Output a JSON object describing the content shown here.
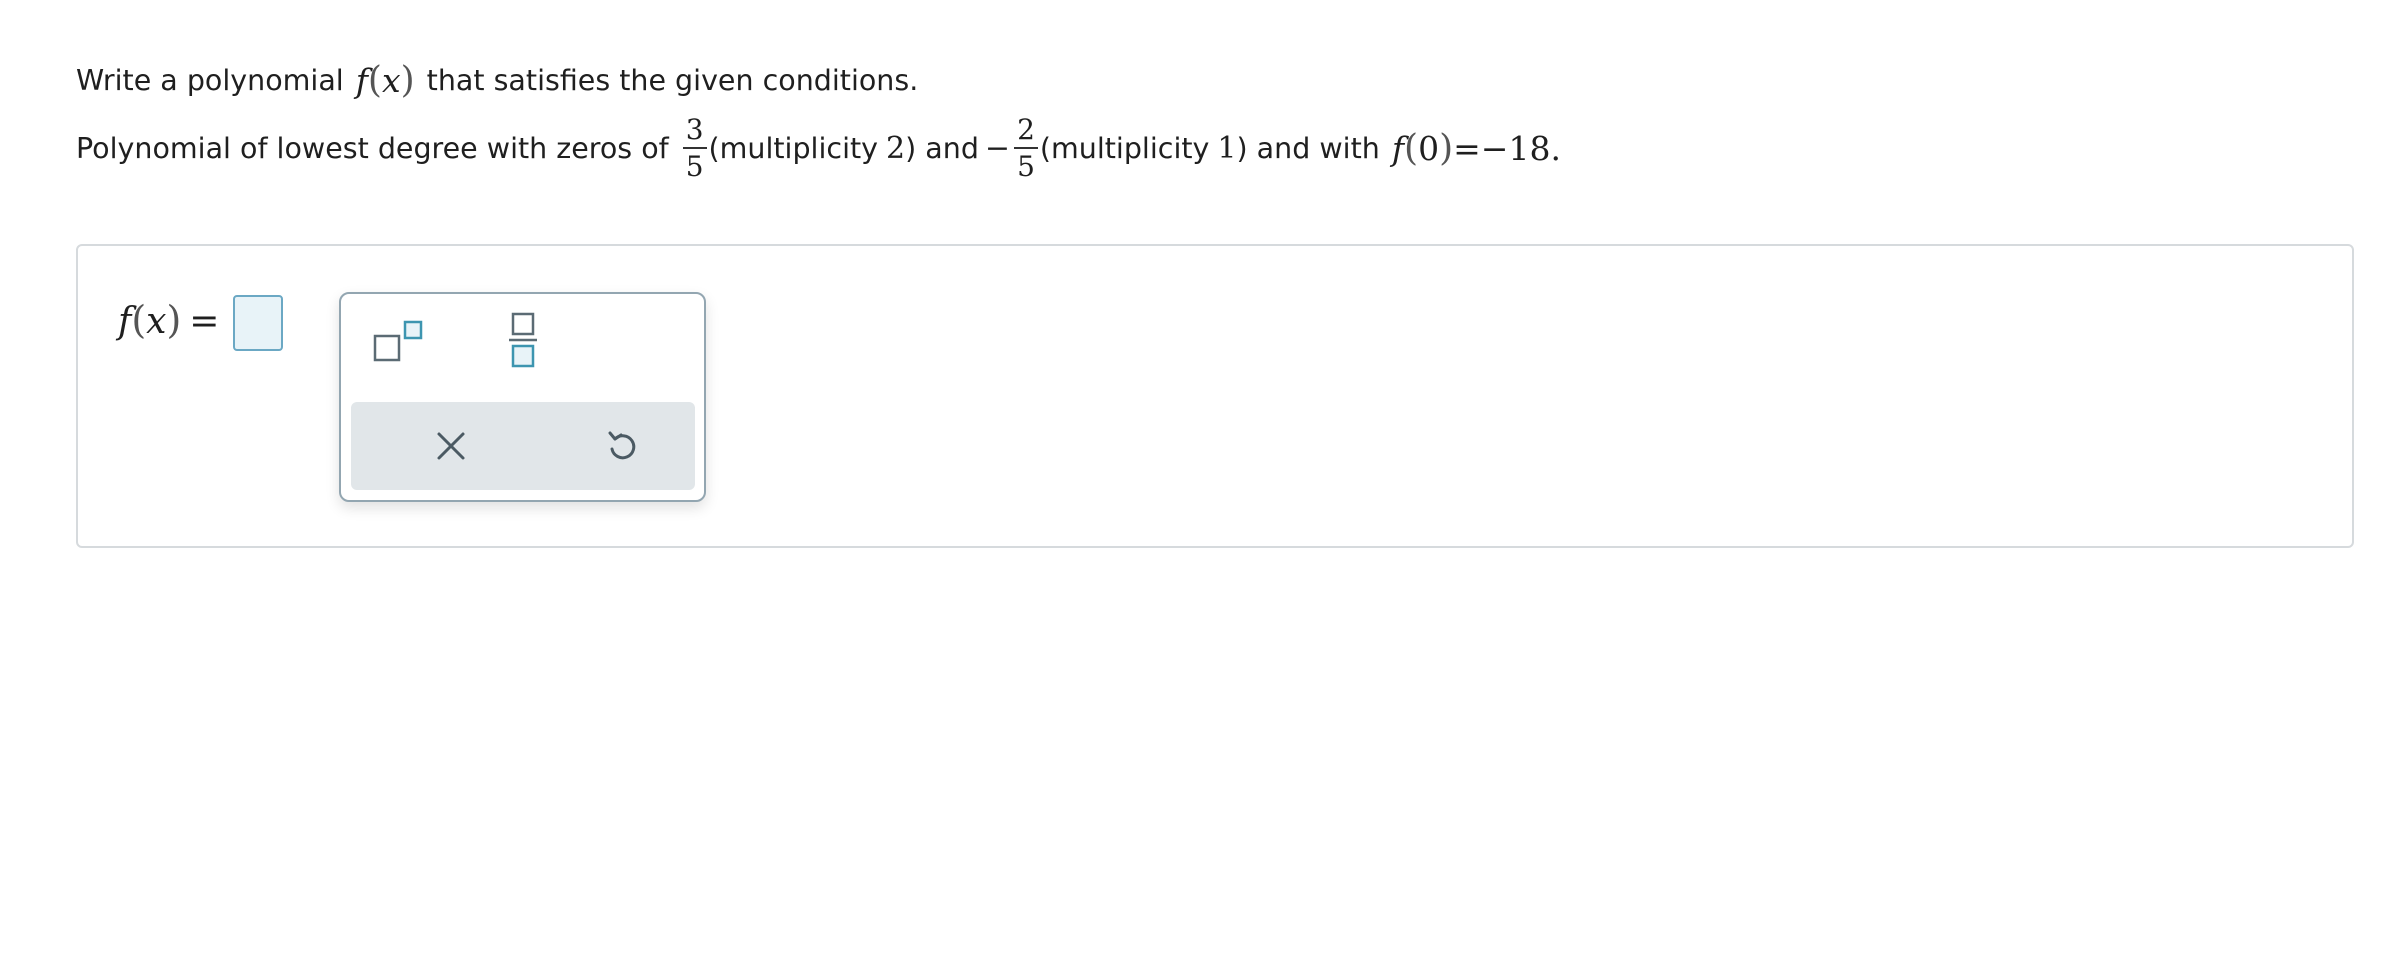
{
  "question": {
    "line1_prefix": "Write a polynomial",
    "func_name": "f",
    "func_var": "x",
    "line1_suffix": "that satisfies the given conditions.",
    "line2_prefix": "Polynomial of lowest degree with zeros of",
    "zero1": {
      "numerator": "3",
      "denominator": "5"
    },
    "mult1_prefix": "(multiplicity",
    "mult1_value": "2",
    "mult1_suffix": ") and",
    "zero2_sign": "−",
    "zero2": {
      "numerator": "2",
      "denominator": "5"
    },
    "mult2_prefix": "(multiplicity",
    "mult2_value": "1",
    "mult2_suffix": ") and with",
    "cond_func": "f",
    "cond_arg": "0",
    "cond_eq": "=",
    "cond_value": "−18",
    "cond_end": "."
  },
  "answer": {
    "label_func": "f",
    "label_var": "x",
    "label_eq": "=",
    "input_value": ""
  },
  "palette": {
    "buttons": [
      {
        "name": "exponent",
        "icon": "superscript-template-icon"
      },
      {
        "name": "fraction",
        "icon": "fraction-template-icon"
      },
      {
        "name": "clear",
        "icon": "close-icon"
      },
      {
        "name": "undo",
        "icon": "undo-icon"
      }
    ]
  },
  "colors": {
    "accent": "#3d95b0",
    "input_border": "#6ba8c4",
    "input_bg": "#e8f3f8",
    "palette_bottom_bg": "#e1e6e9",
    "icon_dark": "#4b5a63"
  }
}
